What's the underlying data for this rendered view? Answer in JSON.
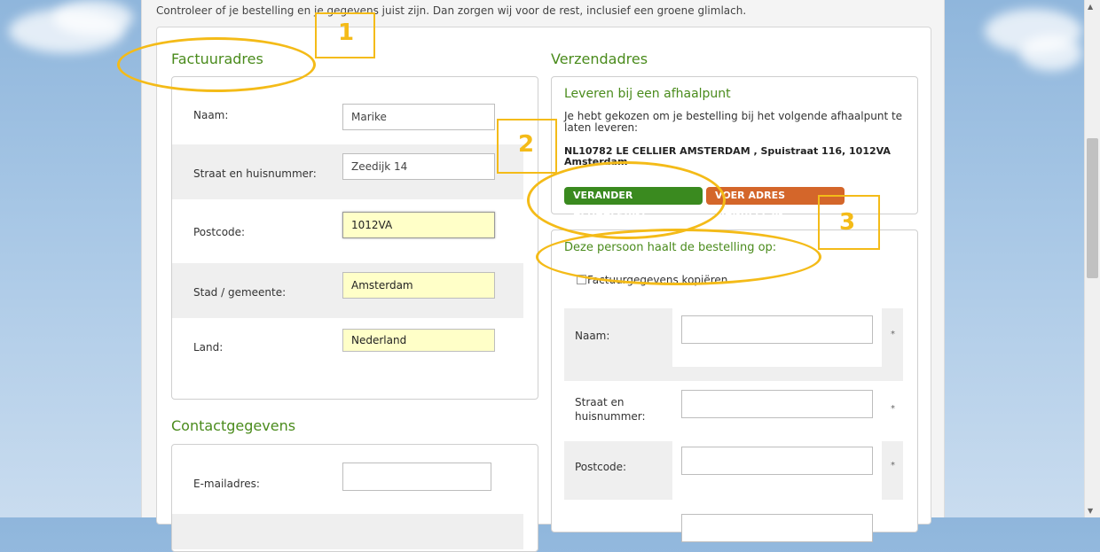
{
  "intro_text": "Controleer of je bestelling en je gegevens juist zijn. Dan zorgen wij voor de rest, inclusief een groene glimlach.",
  "billing": {
    "title": "Factuuradres",
    "fields": [
      {
        "label": "Naam:",
        "value": "Marike"
      },
      {
        "label": "Straat en huisnummer:",
        "value": "Zeedijk 14"
      },
      {
        "label": "Postcode:",
        "value": "1012VA"
      },
      {
        "label": "Stad / gemeente:",
        "value": "Amsterdam"
      },
      {
        "label": "Land:",
        "value": "Nederland"
      }
    ]
  },
  "contact": {
    "title": "Contactgegevens",
    "fields": [
      {
        "label": "E-mailadres:",
        "value": ""
      }
    ]
  },
  "shipping": {
    "title": "Verzendadres",
    "pickup_title": "Leveren bij een afhaalpunt",
    "pickup_text": "Je hebt gekozen om je bestelling bij het volgende afhaalpunt te laten leveren:",
    "pickup_address_line1": "NL10782 LE CELLIER AMSTERDAM , Spuistraat 116, 1012VA",
    "pickup_address_line2": "Amsterdam",
    "change_button": "VERANDER AFHAALPUNT",
    "manual_button": "VOER ADRES MANUEEL IN",
    "collector_title": "Deze persoon haalt de bestelling op:",
    "copy_checkbox_label": "Factuurgegevens kopiëren",
    "fields": [
      {
        "label": "Naam:",
        "value": "",
        "required": "*"
      },
      {
        "label_line1": "Straat en",
        "label_line2": "huisnummer:",
        "value": "",
        "required": "*"
      },
      {
        "label": "Postcode:",
        "value": "",
        "required": "*"
      }
    ]
  },
  "annotations": {
    "n1": "1",
    "n2": "2",
    "n3": "3"
  },
  "colors": {
    "heading_green": "#4a8b1c",
    "button_green": "#3a8a1f",
    "button_orange": "#d4662a",
    "annotation": "#f4bb18",
    "autofill_yellow": "#ffffc8"
  }
}
